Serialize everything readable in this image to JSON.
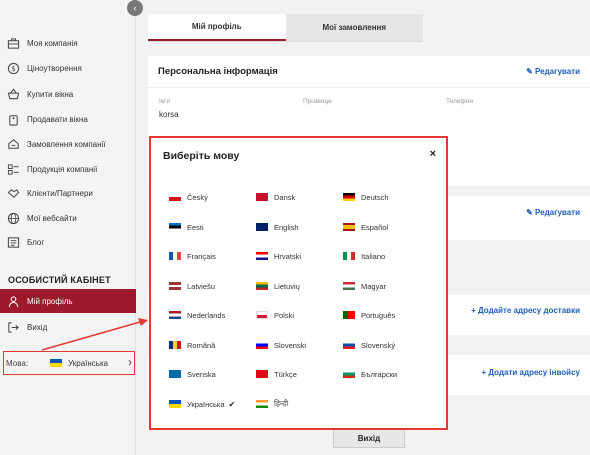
{
  "sidebar": {
    "items": [
      {
        "label": "Моя компанія",
        "icon": "building-icon"
      },
      {
        "label": "Ціноутворення",
        "icon": "dollar-icon"
      },
      {
        "label": "Купити вікна",
        "icon": "basket-icon"
      },
      {
        "label": "Продавати вікна",
        "icon": "tag-icon"
      },
      {
        "label": "Замовлення компанії",
        "icon": "truck-icon"
      },
      {
        "label": "Продукція компанії",
        "icon": "list-icon"
      },
      {
        "label": "Клієнти/Партнери",
        "icon": "handshake-icon"
      },
      {
        "label": "Мої вебсайти",
        "icon": "globe-icon"
      },
      {
        "label": "Блог",
        "icon": "blog-icon"
      }
    ],
    "cabinet_title": "ОСОБИСТИЙ КАБІНЕТ",
    "cabinet_items": [
      {
        "label": "Мій профіль",
        "icon": "user-icon"
      },
      {
        "label": "Вихід",
        "icon": "logout-icon"
      }
    ],
    "language_label": "Мова:",
    "language_value": "Українська"
  },
  "main": {
    "tabs": [
      {
        "label": "Мій профіль"
      },
      {
        "label": "Мої замовлення"
      }
    ],
    "personal": {
      "title": "Персональна інформація",
      "edit_label": "Редагувати",
      "fields": [
        {
          "label": "Ім'я",
          "value": "korsa"
        },
        {
          "label": "Прізвище",
          "value": ""
        },
        {
          "label": "Телефон",
          "value": ""
        }
      ]
    },
    "second_edit_label": "Редагувати",
    "add_delivery": "+ Додайте адресу доставки",
    "add_invoice": "+ Додати адресу інвойсу",
    "exit_button": "Вихід"
  },
  "modal": {
    "title": "Виберіть мову",
    "close": "×",
    "languages": [
      {
        "name": "Český",
        "flag": "cz"
      },
      {
        "name": "Dansk",
        "flag": "dk"
      },
      {
        "name": "Deutsch",
        "flag": "de"
      },
      {
        "name": "Eesti",
        "flag": "ee"
      },
      {
        "name": "English",
        "flag": "gb"
      },
      {
        "name": "Español",
        "flag": "es"
      },
      {
        "name": "Français",
        "flag": "fr"
      },
      {
        "name": "Hrvatski",
        "flag": "hr"
      },
      {
        "name": "Italiano",
        "flag": "it"
      },
      {
        "name": "Latviešu",
        "flag": "lv"
      },
      {
        "name": "Lietuvių",
        "flag": "lt"
      },
      {
        "name": "Magyar",
        "flag": "hu"
      },
      {
        "name": "Nederlands",
        "flag": "nl"
      },
      {
        "name": "Polski",
        "flag": "pl"
      },
      {
        "name": "Português",
        "flag": "pt"
      },
      {
        "name": "Română",
        "flag": "ro"
      },
      {
        "name": "Slovenski",
        "flag": "si"
      },
      {
        "name": "Slovenský",
        "flag": "sk"
      },
      {
        "name": "Svenska",
        "flag": "se"
      },
      {
        "name": "Türkçe",
        "flag": "tr"
      },
      {
        "name": "Български",
        "flag": "bg"
      },
      {
        "name": "Українська",
        "flag": "ua",
        "selected": true
      },
      {
        "name": "हिन्दी",
        "flag": "in"
      }
    ]
  },
  "colors": {
    "accent": "#9c1a2b",
    "link": "#1f5fb5",
    "highlight": "#e53935"
  }
}
